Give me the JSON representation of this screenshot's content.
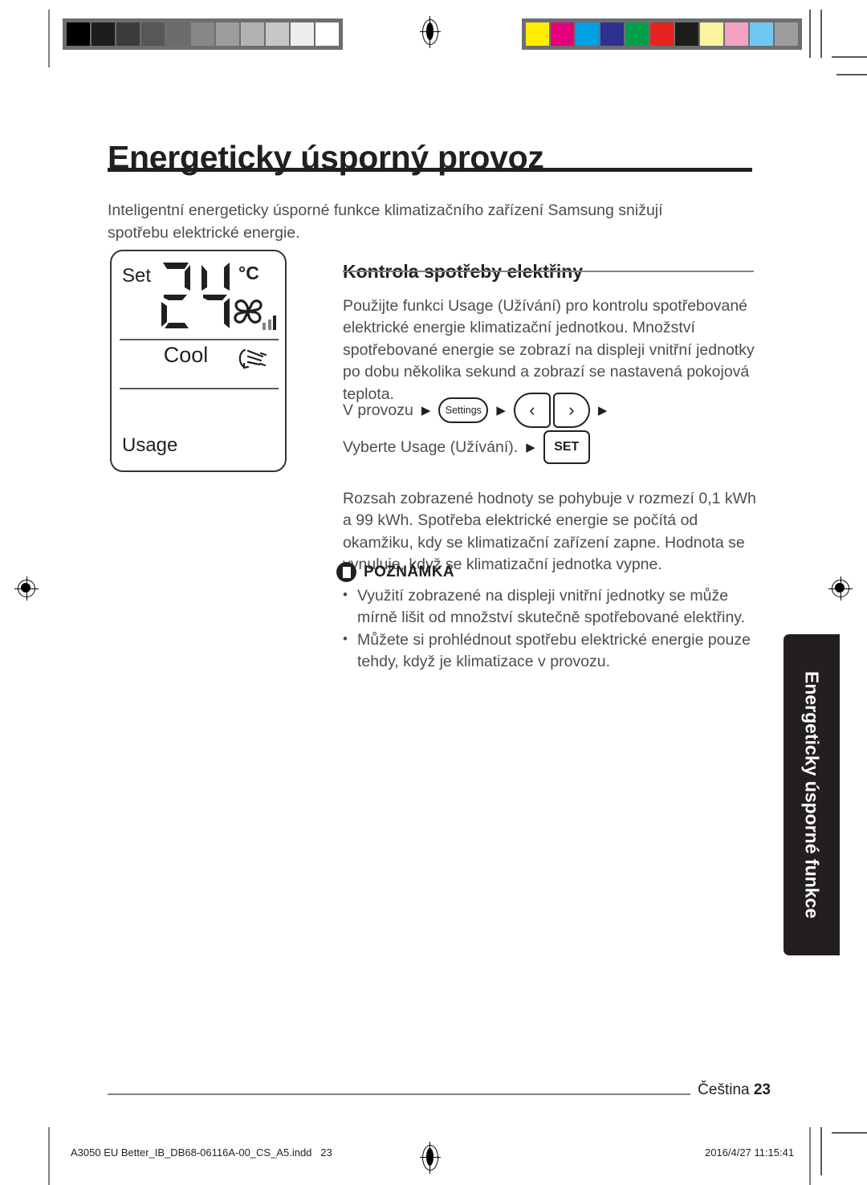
{
  "document": {
    "title": "Energeticky úsporný provoz",
    "intro": "Inteligentní energeticky úsporné funkce klimatizačního zařízení Samsung snižují spotřebu elektrické energie."
  },
  "lcd_display": {
    "set_label": "Set",
    "temperature": "24",
    "unit": "°C",
    "mode": "Cool",
    "usage_label": "Usage",
    "fan_icon": "fan-icon",
    "fan_bars": 3,
    "swing_icon": "airflow-swing-icon"
  },
  "section": {
    "heading": "Kontrola spotřeby elektřiny",
    "paragraph_1": "Použijte funkci Usage (Užívání) pro kontrolu spotřebované elektrické energie klimatizační jednotkou. Množství spotřebované energie se zobrazí na displeji vnitřní jednotky po dobu několika sekund a zobrazí se nastavená pokojová teplota.",
    "paragraph_2": "Rozsah zobrazené hodnoty se pohybuje v rozmezí 0,1 kWh a 99 kWh. Spotřeba elektrické energie se počítá od okamžiku, kdy se klimatizační zařízení zapne. Hodnota se vynuluje, když se klimatizační jednotka vypne."
  },
  "steps": {
    "row_1": {
      "label": "V provozu",
      "settings_button": "Settings",
      "left_button": "‹",
      "right_button": "›",
      "arrow": "▶"
    },
    "row_2": {
      "label": "Vyberte Usage (Užívání).",
      "set_button": "SET",
      "arrow": "▶"
    }
  },
  "note": {
    "title": "POZNÁMKA",
    "icon": "note-document-icon",
    "items": [
      "Využití zobrazené na displeji vnitřní jednotky se může mírně lišit od množství skutečně spotřebované elektřiny.",
      "Můžete si prohlédnout spotřebu elektrické energie pouze tehdy, když je klimatizace v provozu."
    ]
  },
  "side_tab": {
    "label": "Energeticky úsporné funkce",
    "background": "#231f20",
    "text_color": "#ffffff"
  },
  "footer": {
    "language": "Čeština",
    "page_number": "23"
  },
  "print_marks": {
    "file_name": "A3050 EU Better_IB_DB68-06116A-00_CS_A5.indd",
    "file_page": "23",
    "timestamp": "2016/4/27   11:15:41",
    "grayscale_swatches": [
      "#000000",
      "#1d1d1b",
      "#3c3c3b",
      "#575756",
      "#6b6b6b",
      "#878787",
      "#9d9d9c",
      "#b2b2b2",
      "#c6c6c6",
      "#ededed",
      "#ffffff"
    ],
    "color_swatches": [
      "#ffed00",
      "#e6007e",
      "#00a0e3",
      "#2e3191",
      "#00a04a",
      "#e52421",
      "#1d1d1b",
      "#fbf3a0",
      "#f2a2c0",
      "#6ec9f2",
      "#9d9d9c"
    ]
  }
}
